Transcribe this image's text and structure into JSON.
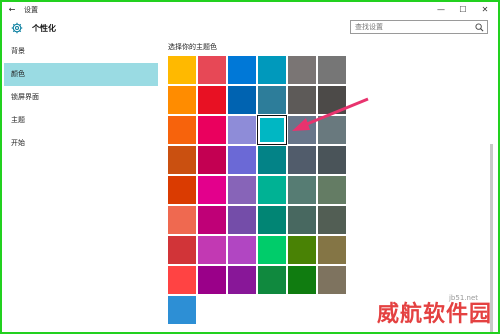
{
  "window": {
    "title": "设置",
    "back_symbol": "←",
    "min_symbol": "—",
    "max_symbol": "☐",
    "close_symbol": "✕"
  },
  "header": {
    "icon": "gear-icon",
    "title": "个性化",
    "search_placeholder": "查找设置"
  },
  "sidebar": {
    "items": [
      {
        "label": "背景",
        "active": false
      },
      {
        "label": "颜色",
        "active": true
      },
      {
        "label": "锁屏界面",
        "active": false
      },
      {
        "label": "主题",
        "active": false
      },
      {
        "label": "开始",
        "active": false
      }
    ]
  },
  "main": {
    "heading": "选择你的主题色",
    "accent_colors": [
      [
        "#ffb900",
        "#e74856",
        "#0078d7",
        "#0099bc",
        "#7a7574",
        "#767676"
      ],
      [
        "#ff8c00",
        "#e81123",
        "#0063b1",
        "#2d7d9a",
        "#5d5a58",
        "#4c4a48"
      ],
      [
        "#f7630c",
        "#ea005e",
        "#8e8cd8",
        "#00b7c3",
        "#68768a",
        "#69797e"
      ],
      [
        "#ca5010",
        "#c30052",
        "#6b69d6",
        "#038387",
        "#515c6b",
        "#4a5459"
      ],
      [
        "#da3b01",
        "#e3008c",
        "#8764b8",
        "#00b294",
        "#567c73",
        "#647c64"
      ],
      [
        "#ef6950",
        "#bf0077",
        "#744da9",
        "#018574",
        "#486860",
        "#525e54"
      ],
      [
        "#d13438",
        "#c239b3",
        "#b146c2",
        "#00cc6a",
        "#498205",
        "#847545"
      ],
      [
        "#ff4343",
        "#9a0089",
        "#881798",
        "#10893e",
        "#107c10",
        "#7e735f"
      ],
      [
        "#2d8fd5"
      ]
    ],
    "selected": {
      "row": 2,
      "col": 3
    }
  },
  "watermark": {
    "text": "威航软件园",
    "sub": "jb51.net"
  }
}
